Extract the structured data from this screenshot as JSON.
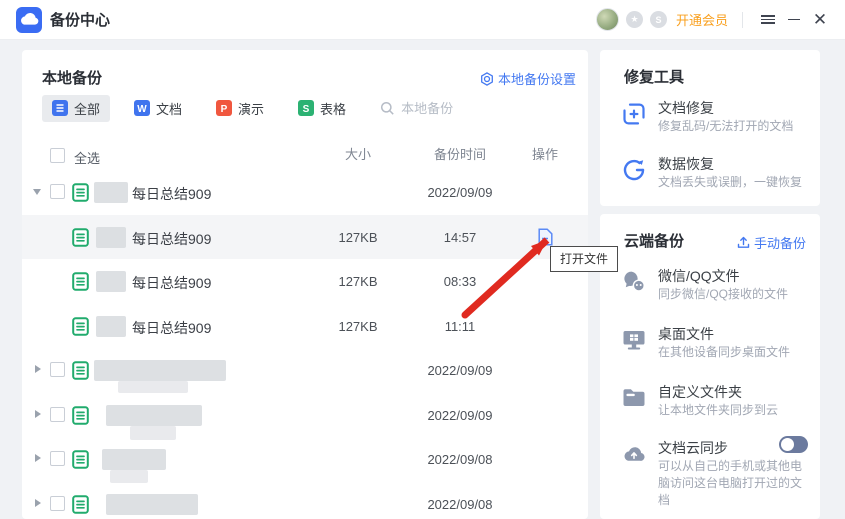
{
  "titlebar": {
    "app_title": "备份中心",
    "membership_label": "开通会员"
  },
  "local_backup": {
    "title": "本地备份",
    "settings_label": "本地备份设置",
    "tabs": [
      {
        "label": "全部"
      },
      {
        "label": "文档"
      },
      {
        "label": "演示"
      },
      {
        "label": "表格"
      }
    ],
    "search_placeholder": "本地备份",
    "select_all_label": "全选",
    "columns": {
      "size": "大小",
      "time": "备份时间",
      "action": "操作"
    },
    "rows": [
      {
        "kind": "group",
        "expanded": true,
        "name": "每日总结909",
        "date": "2022/09/09"
      },
      {
        "kind": "file",
        "name": "每日总结909",
        "size": "127KB",
        "time": "14:57",
        "action": "open-file"
      },
      {
        "kind": "file",
        "name": "每日总结909",
        "size": "127KB",
        "time": "08:33"
      },
      {
        "kind": "file",
        "name": "每日总结909",
        "size": "127KB",
        "time": "11:11"
      },
      {
        "kind": "group",
        "expanded": false,
        "name": "",
        "date": "2022/09/09"
      },
      {
        "kind": "group",
        "expanded": false,
        "name": "",
        "date": "2022/09/09"
      },
      {
        "kind": "group",
        "expanded": false,
        "name": "",
        "date": "2022/09/08"
      },
      {
        "kind": "group",
        "expanded": false,
        "name": "",
        "date": "2022/09/08"
      }
    ]
  },
  "tooltip": {
    "text": "打开文件"
  },
  "repair_tools": {
    "title": "修复工具",
    "items": [
      {
        "title": "文档修复",
        "subtitle": "修复乱码/无法打开的文档"
      },
      {
        "title": "数据恢复",
        "subtitle": "文档丢失或误删，一键恢复"
      }
    ]
  },
  "cloud_backup": {
    "title": "云端备份",
    "manual_backup_label": "手动备份",
    "items": [
      {
        "title": "微信/QQ文件",
        "subtitle": "同步微信/QQ接收的文件"
      },
      {
        "title": "桌面文件",
        "subtitle": "在其他设备同步桌面文件"
      },
      {
        "title": "自定义文件夹",
        "subtitle": "让本地文件夹同步到云"
      },
      {
        "title": "文档云同步",
        "subtitle": "可以从自己的手机或其他电脑访问这台电脑打开过的文档",
        "enabled": false
      }
    ]
  },
  "colors": {
    "accent_blue": "#4479f1",
    "tab_blue": "#4074ee",
    "tab_orange": "#f0573f",
    "tab_green": "#2cb273",
    "file_green": "#21ab6d",
    "member_orange": "#f9a01f",
    "arrow_red": "#e02a20",
    "row_highlight": "#f4f5f7",
    "toggle_off": "#6b7a9e"
  }
}
